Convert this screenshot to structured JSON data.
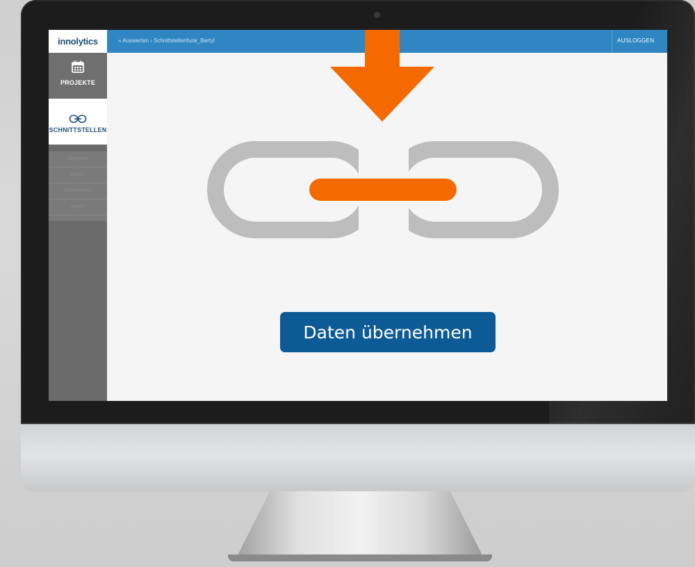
{
  "app": {
    "logo": "innolytics",
    "breadcrumb": "« Auswerten › Schnittstellenfunk_Bertyl",
    "logout_label": "AUSLOGGEN"
  },
  "sidebar": {
    "items": [
      {
        "label": "PROJEKTE",
        "icon": "calendar-icon",
        "active": false
      },
      {
        "label": "SCHNITTSTELLEN",
        "icon": "link-icon",
        "active": true
      }
    ],
    "submenu": [
      "Allgemein",
      "Export",
      "Schnittstellen",
      "Import"
    ]
  },
  "main": {
    "action_label": "Daten übernehmen",
    "illustration": {
      "arrow": "arrow-down-icon",
      "link": "chain-link-icon"
    }
  },
  "colors": {
    "topbar": "#2f86c3",
    "sidebar": "#6b6b6b",
    "accent_orange": "#f56a00",
    "chain_gray": "#bdbdbd",
    "button": "#0d5b96"
  }
}
